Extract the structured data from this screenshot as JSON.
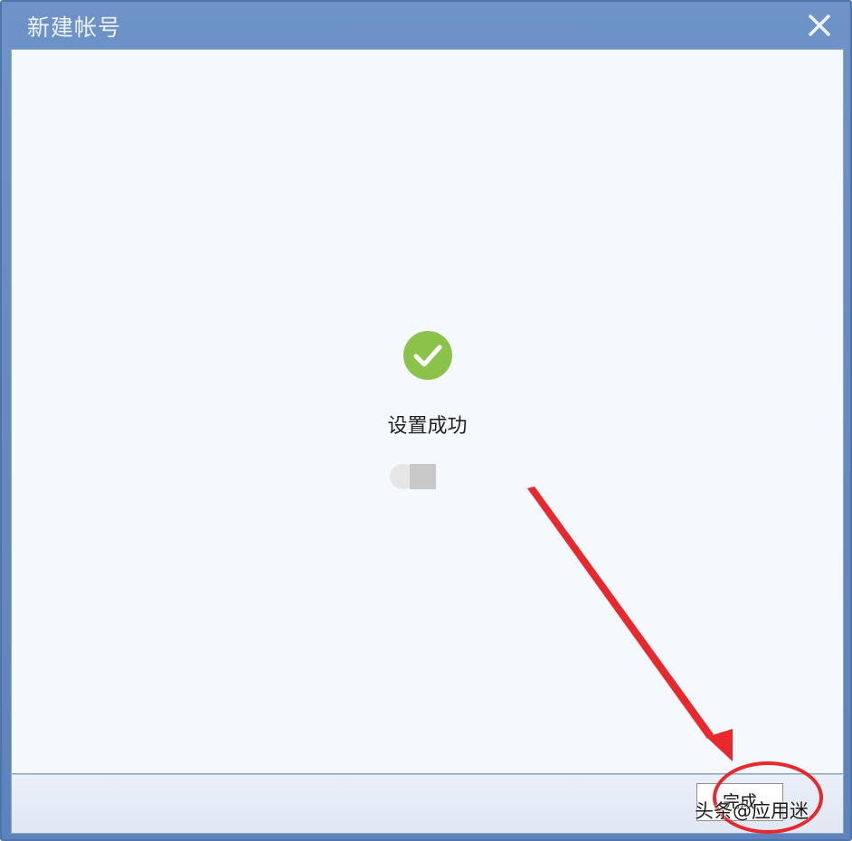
{
  "dialog": {
    "title": "新建帐号",
    "close_icon": "close-icon"
  },
  "content": {
    "status_icon": "check-circle-icon",
    "status_icon_color": "#8bc24a",
    "status_text": "设置成功",
    "loader_icon": "toggle-loader-icon"
  },
  "footer": {
    "finish_label": "完成"
  },
  "annotation": {
    "arrow_color": "#e8282c",
    "circle_color": "#e8282c",
    "watermark": "头条@应用迷"
  }
}
